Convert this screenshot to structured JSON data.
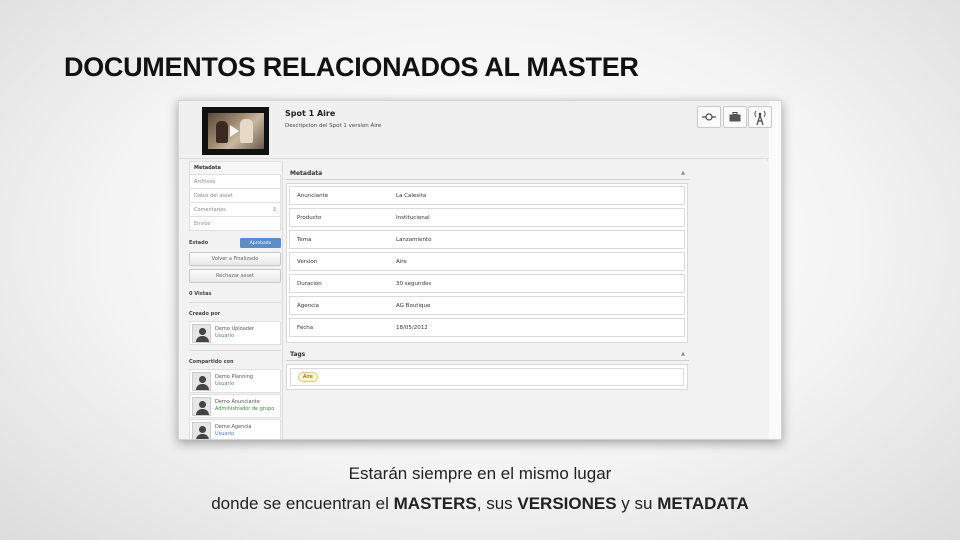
{
  "slide": {
    "title": "DOCUMENTOS RELACIONADOS AL MASTER",
    "caption_line1": "Estarán siempre en el mismo lugar",
    "caption_line2": {
      "p1": "donde se encuentran el ",
      "b1": "MASTERS",
      "p2": ", sus ",
      "b2": "VERSIONES",
      "p3": " y su ",
      "b3": "METADATA"
    }
  },
  "asset": {
    "title": "Spot 1 Aire",
    "description": "Descripcion del Spot 1 version Aire",
    "header_buttons": [
      "toggle-icon",
      "briefcase-icon",
      "broadcast-icon"
    ]
  },
  "sidebar": {
    "nav": [
      {
        "label": "Metadata",
        "count": ""
      },
      {
        "label": "Archivos",
        "count": ""
      },
      {
        "label": "Datos del asset",
        "count": ""
      },
      {
        "label": "Comentarios",
        "count": "3"
      },
      {
        "label": "Envíos",
        "count": ""
      }
    ],
    "estado_label": "Estado",
    "estado_value": "Aprobado",
    "btn_finalizado": "Volver a Finalizado",
    "btn_rechazar": "Rechazar asset",
    "vistas": "0 Vistas",
    "creado_por": "Creado por",
    "creator": {
      "name": "Demo Uploader",
      "role": "Usuario"
    },
    "compartido_con": "Compartido con",
    "shared": [
      {
        "name": "Demo Planning",
        "role": "Usuario"
      },
      {
        "name": "Demo Anunciante",
        "role": "Administrador de grupo"
      },
      {
        "name": "Demo Agencia",
        "role": "Usuario"
      }
    ]
  },
  "metadata": {
    "heading": "Metadata",
    "rows": [
      {
        "key": "Anunciante",
        "value": "La Calesita"
      },
      {
        "key": "Producto",
        "value": "Institucional"
      },
      {
        "key": "Tema",
        "value": "Lanzamiento"
      },
      {
        "key": "Version",
        "value": "Aire"
      },
      {
        "key": "Duración",
        "value": "30 segundos"
      },
      {
        "key": "Agencia",
        "value": "AG Boutique"
      },
      {
        "key": "Fecha",
        "value": "18/05/2012"
      }
    ]
  },
  "tags": {
    "heading": "Tags",
    "items": [
      "Aire"
    ]
  },
  "colors": {
    "accent": "#5b8ec7",
    "link": "#4a78b8",
    "admin_role": "#3a8a3a"
  }
}
